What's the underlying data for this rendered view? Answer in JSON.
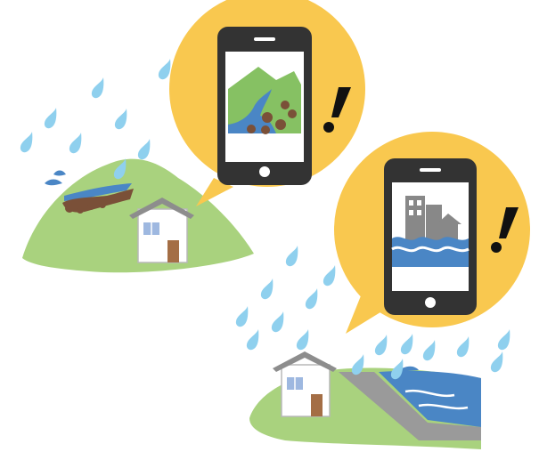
{
  "colors": {
    "background": "#ffffff",
    "raindrop": "#8fd0ee",
    "hill": "#a9d27e",
    "hill_dark": "#8fc05e",
    "bubble": "#f9c84f",
    "phone_body": "#333333",
    "phone_screen": "#ffffff",
    "water": "#4a86c5",
    "landslide": "#7a5038",
    "mountain": "#86c163",
    "building": "#888888",
    "house_wall": "#ffffff",
    "house_roof": "#8d8d8d",
    "house_window": "#9eb8e0",
    "house_door": "#a46e45",
    "exclamation": "#111111",
    "embankment": "#9a9a9a"
  },
  "icons": {
    "phone_landslide": "smartphone-landslide-warning-icon",
    "phone_flood": "smartphone-flood-warning-icon",
    "alert": "exclamation-icon",
    "rain": "raindrop-icon",
    "house": "house-icon"
  }
}
